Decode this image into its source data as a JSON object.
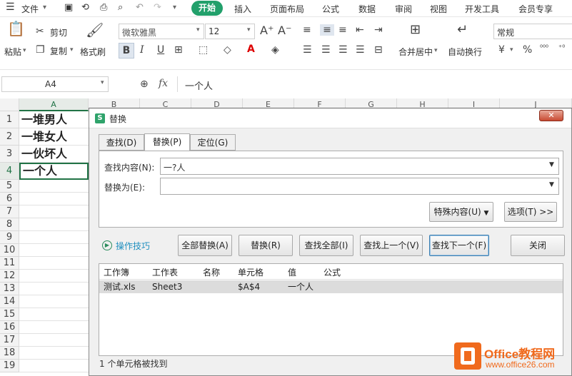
{
  "menubar": {
    "file": "文件",
    "tabs": [
      "开始",
      "插入",
      "页面布局",
      "公式",
      "数据",
      "审阅",
      "视图",
      "开发工具",
      "会员专享"
    ]
  },
  "ribbon": {
    "paste": "粘贴",
    "cut": "剪切",
    "copy": "复制",
    "format_painter": "格式刷",
    "font_name": "微软雅黑",
    "font_size": "12",
    "merge_center": "合并居中",
    "wrap_text": "自动换行",
    "number_format": "常规"
  },
  "formula_bar": {
    "name_box": "A4",
    "fx": "fx",
    "content": "一个人"
  },
  "sheet": {
    "columns": [
      "A",
      "B",
      "C",
      "D",
      "E",
      "F",
      "G",
      "H",
      "I",
      "J"
    ],
    "rows": [
      "1",
      "2",
      "3",
      "4",
      "5",
      "6",
      "7",
      "8",
      "9",
      "10",
      "11",
      "12",
      "13",
      "14",
      "15",
      "16",
      "17",
      "18",
      "19"
    ],
    "cells_a": [
      "一堆男人",
      "一堆女人",
      "一伙坏人",
      "一个人"
    ]
  },
  "dialog": {
    "title": "替换",
    "tabs": [
      "查找(D)",
      "替换(P)",
      "定位(G)"
    ],
    "find_label": "查找内容(N):",
    "find_value": "一?人",
    "replace_label": "替换为(E):",
    "replace_value": "",
    "special_button": "特殊内容(U)",
    "options_button": "选项(T) >>",
    "tips": "操作技巧",
    "replace_all": "全部替换(A)",
    "replace": "替换(R)",
    "find_all": "查找全部(I)",
    "find_prev": "查找上一个(V)",
    "find_next": "查找下一个(F)",
    "close": "关闭",
    "results_headers": [
      "工作簿",
      "工作表",
      "名称",
      "单元格",
      "值",
      "公式"
    ],
    "results_rows": [
      [
        "测试.xls",
        "Sheet3",
        "",
        "$A$4",
        "一个人",
        ""
      ]
    ],
    "status": "1 个单元格被找到"
  },
  "watermark": {
    "brand": "Office教程网",
    "url": "www.office26.com"
  },
  "colors": {
    "accent": "#22a06b",
    "selection": "#217346",
    "brand_orange": "#f06a1d"
  }
}
